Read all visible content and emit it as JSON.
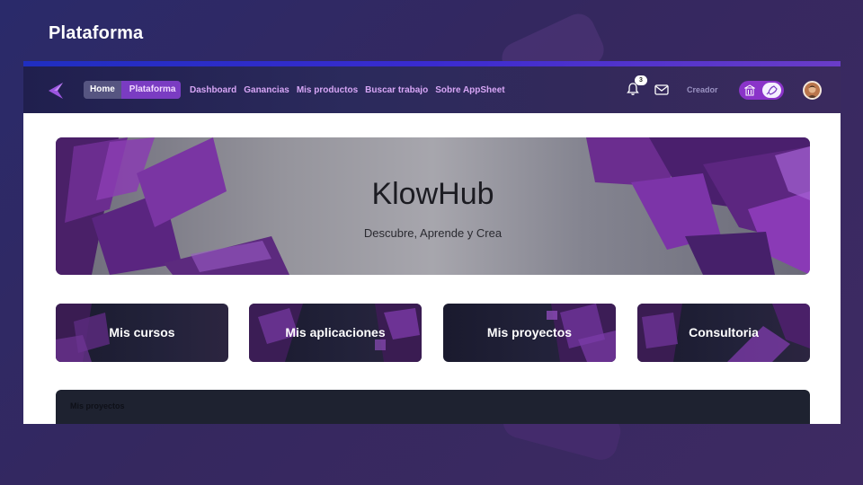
{
  "page": {
    "title": "Plataforma"
  },
  "header": {
    "segment": {
      "home_label": "Home",
      "active_label": "Plataforma"
    },
    "nav": [
      {
        "label": "Dashboard"
      },
      {
        "label": "Ganancias"
      },
      {
        "label": "Mis productos"
      },
      {
        "label": "Buscar trabajo"
      },
      {
        "label": "Sobre AppSheet"
      }
    ],
    "notifications": {
      "count": "3",
      "icon": "bell-icon"
    },
    "mail_icon": "mail-icon",
    "creator_label": "Creador",
    "toggle": {
      "left_icon": "building-icon",
      "right_icon": "rocket-icon"
    }
  },
  "hero": {
    "title": "KlowHub",
    "subtitle": "Descubre, Aprende y Crea"
  },
  "cards": [
    {
      "label": "Mis cursos"
    },
    {
      "label": "Mis aplicaciones"
    },
    {
      "label": "Mis proyectos"
    },
    {
      "label": "Consultoria"
    }
  ],
  "panel": {
    "title": "Mis proyectos"
  },
  "colors": {
    "accent_purple": "#8a34c9",
    "nav_link": "#d7a6f6",
    "topbar": "#2b2a5c",
    "card_bg": "#1a1a2e"
  }
}
